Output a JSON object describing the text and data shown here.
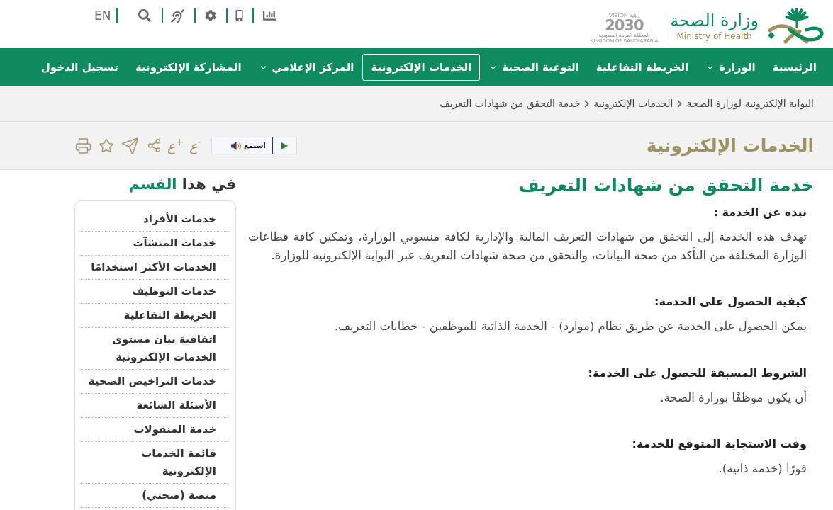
{
  "header": {
    "language": "EN",
    "logo": {
      "arabic": "وزارة الصحة",
      "english": "Ministry of Health"
    },
    "vision": {
      "word": "VISION",
      "arabic": "رؤية",
      "year": "2030",
      "country_ar": "المملكة العربية السعودية",
      "country_en": "KINGDOM OF SAUDI ARABIA"
    }
  },
  "nav": [
    {
      "label": "الرئيسية",
      "has_menu": false,
      "selected": false
    },
    {
      "label": "الوزارة",
      "has_menu": true,
      "selected": false
    },
    {
      "label": "الخريطة التفاعلية",
      "has_menu": false,
      "selected": false
    },
    {
      "label": "التوعية الصحية",
      "has_menu": true,
      "selected": false
    },
    {
      "label": "الخدمات الإلكترونية",
      "has_menu": false,
      "selected": true
    },
    {
      "label": "المركز الإعلامي",
      "has_menu": true,
      "selected": false
    },
    {
      "label": "المشاركة الإلكترونية",
      "has_menu": false,
      "selected": false
    },
    {
      "label": "تسجيل الدخول",
      "has_menu": false,
      "selected": false
    }
  ],
  "breadcrumb": [
    "البوابة الإلكترونية لوزارة الصحة",
    "الخدمات الإلكترونية",
    "خدمة التحقق من شهادات التعريف"
  ],
  "page_title": "الخدمات الإلكترونية",
  "listen": {
    "label": "استمع"
  },
  "font_controls": [
    "ع$^{-}$",
    "ع$^{+}$"
  ],
  "article": {
    "title": "خدمة التحقق من شهادات التعريف",
    "sections": [
      {
        "heading": "نبذة عن الخدمة :",
        "body": "تهدف هذه الخدمة إلى التحقق من شهادات التعريف المالية والإدارية لكافة منسوبي الوزارة، وتمكين كافة قطاعات الوزارة المختلفة من التأكد من صحة البيانات، والتحقق من صحة شهادات التعريف عبر البوابة الإلكترونية للوزارة."
      },
      {
        "heading": "كيفية الحصول على الخدمة:",
        "body": "يمكن الحصول على الخدمة عن طريق نظام (موارد) - الخدمة الذاتية للموظفين - خطابات التعريف."
      },
      {
        "heading": "الشروط المسبقة للحصول على الخدمة:",
        "body": "أن يكون موظفًا بوزارة الصحة."
      },
      {
        "heading": "وقت الاستجابة المتوقع للخدمة:",
        "body": "فورًا (خدمة ذاتية)."
      }
    ]
  },
  "sidebar": {
    "title": "في هذا",
    "title_accent": "القسم",
    "items": [
      "خدمات الأفراد",
      "خدمات المنشآت",
      "الخدمات الأكثر استخدامًا",
      "خدمات التوظيف",
      "الخريطة التفاعلية",
      "اتفاقية بيان مستوى الخدمات الإلكترونية",
      "خدمات التراخيص الصحية",
      "الأسئلة الشائعة",
      "خدمة المنقولات",
      "قائمة الخدمات الإلكترونية",
      "منصة (صحتي)"
    ]
  }
}
